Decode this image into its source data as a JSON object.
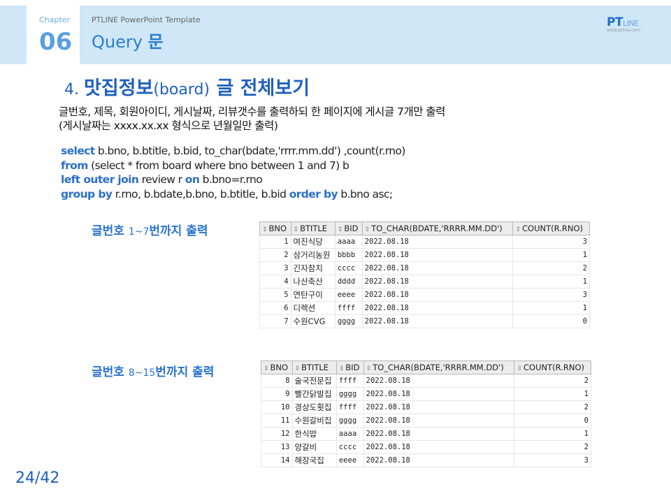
{
  "header": {
    "chapter_label": "Chapter",
    "chapter_number": "06",
    "template_name": "PTLINE PowerPoint Template",
    "title_latin": "Query ",
    "title_korean": "문",
    "logo_main": "PT",
    "logo_accent": "LINE",
    "logo_sub": "www.ptline.com"
  },
  "section": {
    "number": "4. ",
    "title_a": "맛집정보",
    "title_b": "(board)",
    "title_c": " 글 전체보기"
  },
  "description": {
    "line1": "글번호, 제목, 회원아이디, 게시날짜, 리뷰갯수를 출력하되 한 페이지에 게시글 7개만 출력",
    "line2": "(게시날짜는 xxxx.xx.xx 형식으로 년월일만 출력)"
  },
  "code": {
    "l1_kw": "select",
    "l1_rest": " b.bno, b.btitle, b.bid, to_char(bdate,'rrrr.mm.dd') ,count(r.rno)",
    "l2_kw": "from",
    "l2_rest": " (select * from board where bno between 1 and 7) b",
    "l3_kw1": "left outer join",
    "l3_mid": " review r ",
    "l3_kw2": "on",
    "l3_rest": " b.bno=r.rno",
    "l4_kw1": "group by",
    "l4_mid": " r.rno, b.bdate,b.bno, b.btitle, b.bid ",
    "l4_kw2": "order by",
    "l4_rest": " b.bno asc;"
  },
  "result1": {
    "label_a": "글번호 ",
    "label_b": "1~7",
    "label_c": "번까지 출력",
    "columns": [
      "BNO",
      "BTITLE",
      "BID",
      "TO_CHAR(BDATE,'RRRR.MM.DD')",
      "COUNT(R.RNO)"
    ],
    "rows": [
      [
        "1",
        "여진식당",
        "aaaa",
        "2022.08.18",
        "3"
      ],
      [
        "2",
        "삼거리농원",
        "bbbb",
        "2022.08.18",
        "1"
      ],
      [
        "3",
        "긴자참치",
        "cccc",
        "2022.08.18",
        "2"
      ],
      [
        "4",
        "나산축산",
        "dddd",
        "2022.08.18",
        "1"
      ],
      [
        "5",
        "연탄구이",
        "eeee",
        "2022.08.18",
        "3"
      ],
      [
        "6",
        "디렉션",
        "ffff",
        "2022.08.18",
        "1"
      ],
      [
        "7",
        "수원CVG",
        "gggg",
        "2022.08.18",
        "0"
      ]
    ]
  },
  "result2": {
    "label_a": "글번호 ",
    "label_b": "8~15",
    "label_c": "번까지 출력",
    "columns": [
      "BNO",
      "BTITLE",
      "BID",
      "TO_CHAR(BDATE,'RRRR.MM.DD')",
      "COUNT(R.RNO)"
    ],
    "rows": [
      [
        "8",
        "술국전문집",
        "ffff",
        "2022.08.18",
        "2"
      ],
      [
        "9",
        "빨간닭발집",
        "gggg",
        "2022.08.18",
        "1"
      ],
      [
        "10",
        "경상도횟집",
        "ffff",
        "2022.08.18",
        "2"
      ],
      [
        "11",
        "수원갈비집",
        "gggg",
        "2022.08.18",
        "0"
      ],
      [
        "12",
        "한식밥",
        "aaaa",
        "2022.08.18",
        "1"
      ],
      [
        "13",
        "양갈비",
        "cccc",
        "2022.08.18",
        "2"
      ],
      [
        "14",
        "해장국집",
        "eeee",
        "2022.08.18",
        "3"
      ]
    ]
  },
  "pager": "24/42"
}
